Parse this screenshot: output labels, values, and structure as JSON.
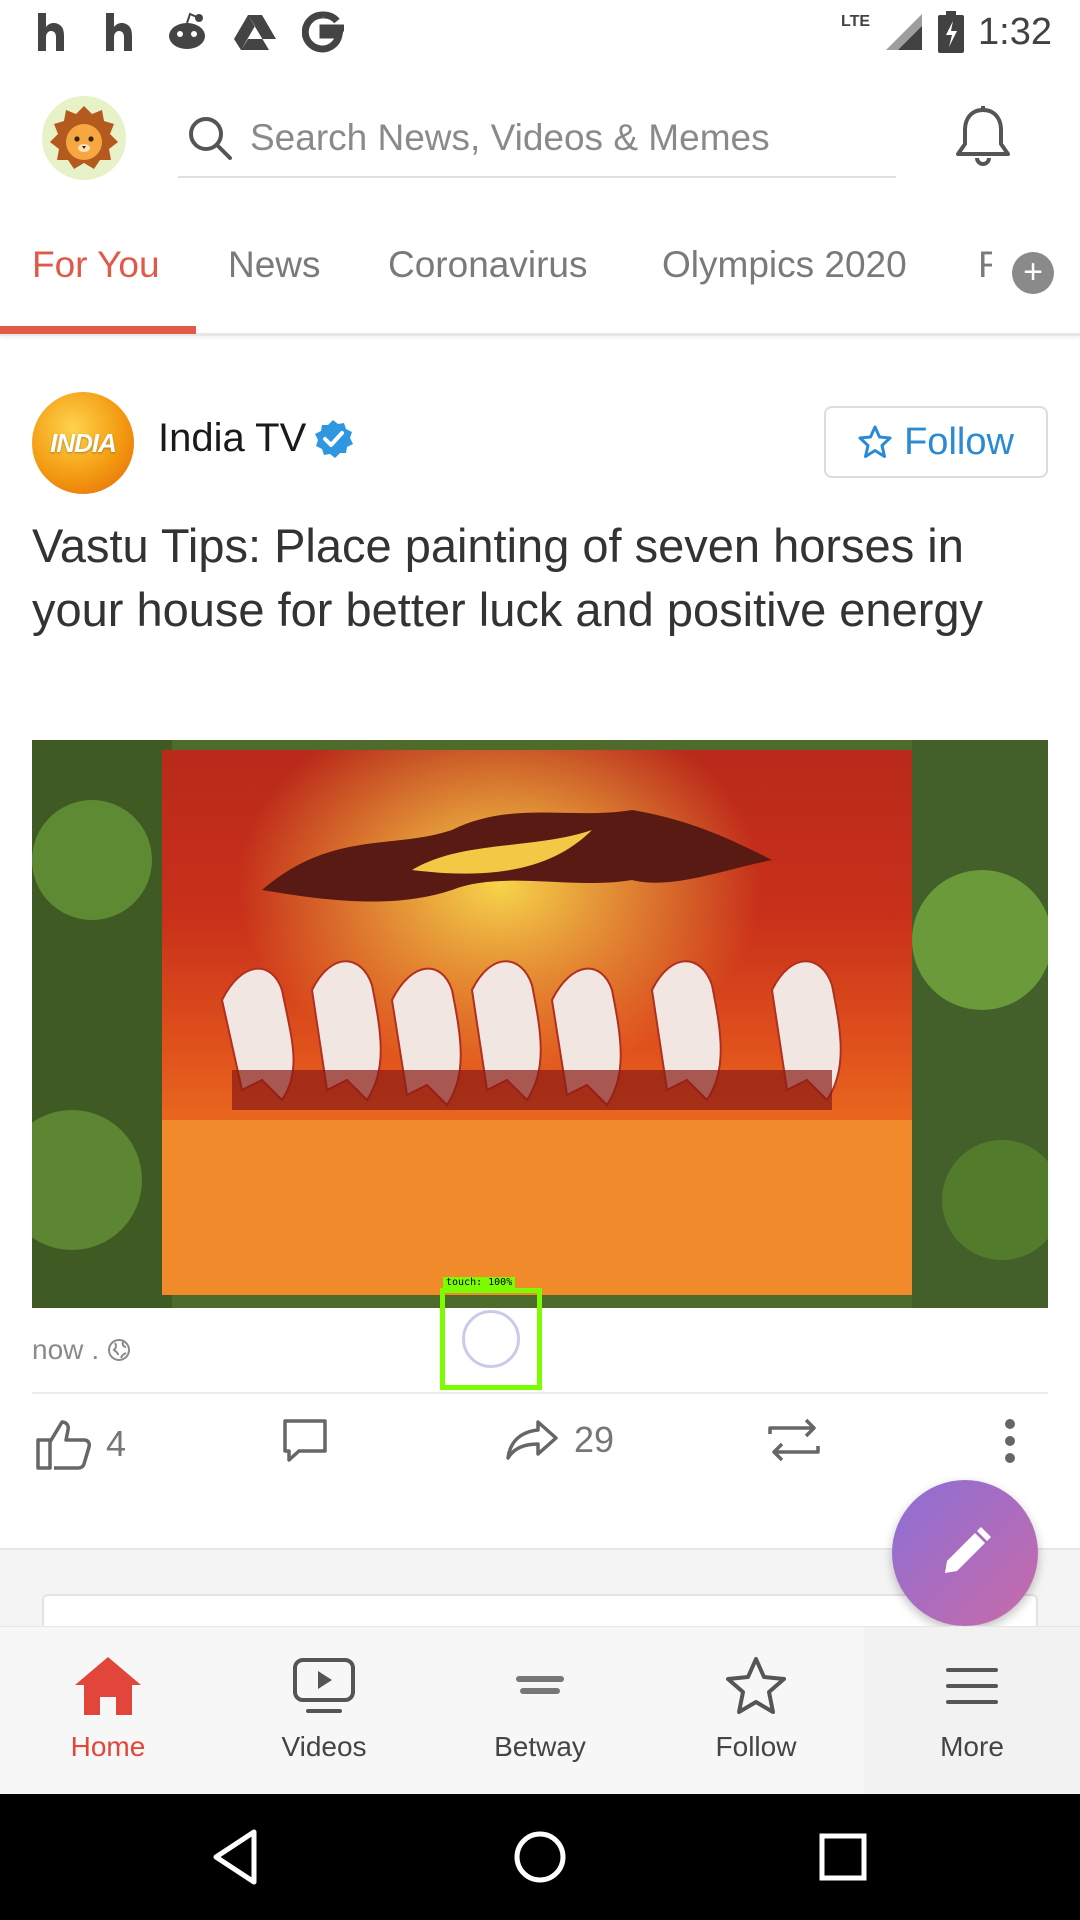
{
  "status_bar": {
    "network": "LTE",
    "time": "1:32"
  },
  "search": {
    "placeholder": "Search News, Videos & Memes"
  },
  "tabs": [
    {
      "label": "For You",
      "active": true
    },
    {
      "label": "News",
      "active": false
    },
    {
      "label": "Coronavirus",
      "active": false
    },
    {
      "label": "Olympics 2020",
      "active": false
    },
    {
      "label": "F",
      "active": false
    }
  ],
  "post": {
    "publisher_logo_text": "INDIA",
    "publisher": "India TV",
    "follow_label": "Follow",
    "title": "Vastu Tips: Place painting of seven horses in your house for better luck and positive energy",
    "time": "now",
    "meta_separator": ".",
    "likes": "4",
    "shares": "29"
  },
  "touch_overlay": {
    "label": "touch: 100%"
  },
  "bottom_nav": [
    {
      "label": "Home",
      "icon": "home-icon",
      "active": true
    },
    {
      "label": "Videos",
      "icon": "video-icon",
      "active": false
    },
    {
      "label": "Betway",
      "icon": "betway-logo",
      "active": false
    },
    {
      "label": "Follow",
      "icon": "star-icon",
      "active": false
    },
    {
      "label": "More",
      "icon": "menu-icon",
      "active": false
    }
  ],
  "colors": {
    "accent": "#e05a47",
    "link": "#2a8ad4",
    "home_active": "#e2463a"
  }
}
